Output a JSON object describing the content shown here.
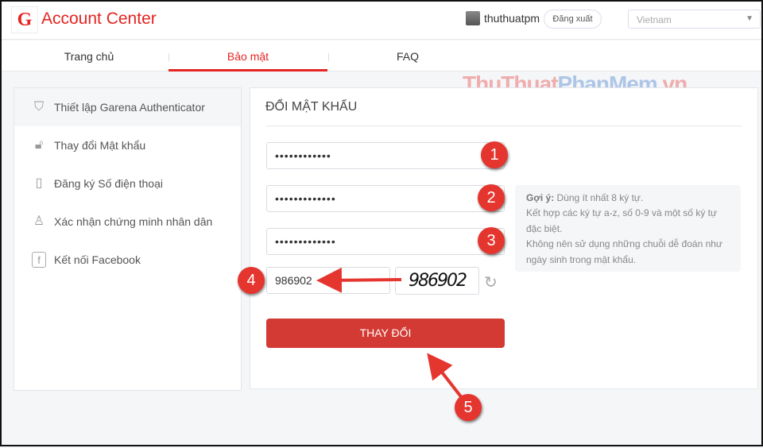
{
  "header": {
    "brand": "Account Center",
    "username": "thuthuatpm",
    "logout": "Đăng xuất",
    "country": "Vietnam"
  },
  "nav": {
    "tabs": [
      {
        "label": "Trang chủ"
      },
      {
        "label": "Bảo mật",
        "active": true
      },
      {
        "label": "FAQ"
      }
    ]
  },
  "sidebar": {
    "items": [
      {
        "label": "Thiết lập Garena Authenticator",
        "icon": "shield-icon"
      },
      {
        "label": "Thay đổi Mật khẩu",
        "icon": "lock-icon"
      },
      {
        "label": "Đăng ký Số điện thoại",
        "icon": "phone-icon"
      },
      {
        "label": "Xác nhận chứng minh nhân dân",
        "icon": "user-icon"
      },
      {
        "label": "Kết nối Facebook",
        "icon": "facebook-icon"
      }
    ]
  },
  "form": {
    "title": "ĐỔI MẬT KHẨU",
    "current_password": "••••••••••••",
    "new_password": "•••••••••••••",
    "confirm_password": "•••••••••••••",
    "captcha_value": "986902",
    "captcha_image_text": "986902",
    "submit": "THAY ĐỔI",
    "hint_label": "Gợi ý:",
    "hint_lines": [
      "Dùng ít nhất 8 ký tự.",
      "Kết hợp các ký tự a-z, số 0-9 và một số ký tự đặc biệt.",
      "Không nên sử dụng những chuỗi dễ đoán như ngày sinh trong mật khẩu."
    ]
  },
  "annotations": [
    "1",
    "2",
    "3",
    "4",
    "5"
  ],
  "watermark": {
    "part1": "ThuThuat",
    "part2": "PhanMem",
    "part3": ".vn"
  },
  "colors": {
    "accent": "#e52421",
    "button": "#d23a33",
    "badge": "#e5352f"
  }
}
